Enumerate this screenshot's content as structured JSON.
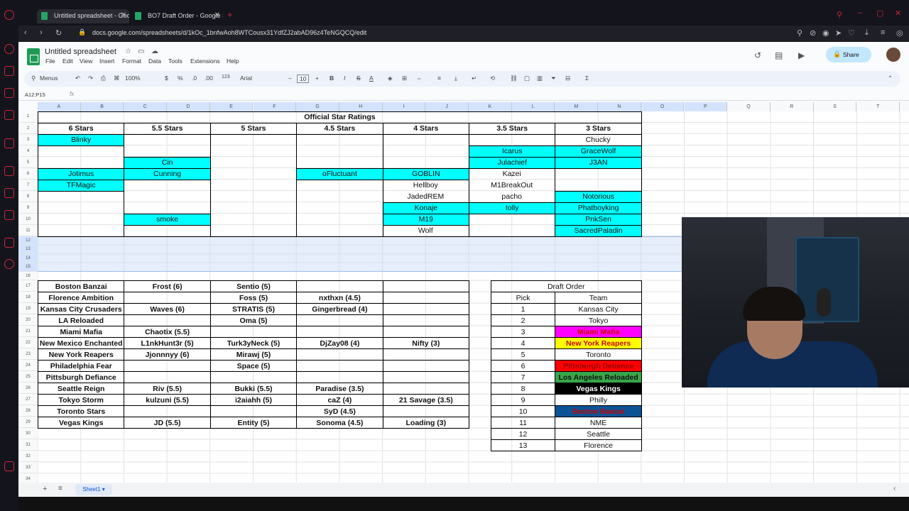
{
  "browser": {
    "tabs": [
      "Untitled spreadsheet - Goo",
      "BO7 Draft Order - Google S"
    ],
    "url": "docs.google.com/spreadsheets/d/1kOc_1bnfwAoh8WTCousx31YdfZJ2abAD96z4TeNGQCQ/edit"
  },
  "doc": {
    "title": "Untitled spreadsheet",
    "menus": [
      "File",
      "Edit",
      "View",
      "Insert",
      "Format",
      "Data",
      "Tools",
      "Extensions",
      "Help"
    ],
    "share_label": "Share"
  },
  "toolbar": {
    "menus_label": "Menus",
    "zoom": "100%",
    "currency": "$",
    "percent": "%",
    "dec_less": ".0",
    "dec_more": ".00",
    "number_format": "123",
    "font": "Arial",
    "font_size": "10"
  },
  "formula_bar": {
    "name_box": "A12:P15",
    "fx": "fx"
  },
  "columns": [
    "A",
    "B",
    "C",
    "D",
    "E",
    "F",
    "G",
    "H",
    "I",
    "J",
    "K",
    "L",
    "M",
    "N",
    "O",
    "P",
    "Q",
    "R",
    "S",
    "T"
  ],
  "rows": [
    "1",
    "2",
    "3",
    "4",
    "5",
    "6",
    "7",
    "8",
    "9",
    "10",
    "11",
    "12",
    "13",
    "14",
    "15",
    "16",
    "17",
    "18",
    "19",
    "20",
    "21",
    "22",
    "23",
    "24",
    "25",
    "26",
    "27",
    "28",
    "29",
    "30",
    "31",
    "32",
    "33",
    "34"
  ],
  "sheet": {
    "tab": "Sheet1"
  },
  "colors": {
    "cyan": "#00ffff",
    "magenta": "#ff00ff",
    "yellow": "#ffff00",
    "red": "#ff0000",
    "green": "#38a649",
    "black": "#000000",
    "blue": "#0b5394"
  },
  "ratings": {
    "title": "Official Star Ratings",
    "headers": [
      "6 Stars",
      "5.5 Stars",
      "5 Stars",
      "4.5 Stars",
      "4 Stars",
      "3.5 Stars",
      "3 Stars"
    ],
    "cells": [
      {
        "r": 3,
        "c": 0,
        "t": "Blinky",
        "hl": true
      },
      {
        "r": 3,
        "c": 6,
        "t": "Chucky",
        "hl": false
      },
      {
        "r": 4,
        "c": 5,
        "t": "Icarus",
        "hl": true
      },
      {
        "r": 4,
        "c": 6,
        "t": "GraceWolf",
        "hl": true
      },
      {
        "r": 5,
        "c": 1,
        "t": "Cin",
        "hl": true
      },
      {
        "r": 5,
        "c": 5,
        "t": "Julachief",
        "hl": true
      },
      {
        "r": 5,
        "c": 6,
        "t": "J3AN",
        "hl": true
      },
      {
        "r": 6,
        "c": 0,
        "t": "Jotimus",
        "hl": true
      },
      {
        "r": 6,
        "c": 1,
        "t": "Cunning",
        "hl": true
      },
      {
        "r": 6,
        "c": 3,
        "t": "oFluctuant",
        "hl": true
      },
      {
        "r": 6,
        "c": 4,
        "t": "GOBLIN",
        "hl": true
      },
      {
        "r": 6,
        "c": 5,
        "t": "Kazei",
        "hl": false
      },
      {
        "r": 7,
        "c": 0,
        "t": "TFMagic",
        "hl": true
      },
      {
        "r": 7,
        "c": 4,
        "t": "Hellboy",
        "hl": false
      },
      {
        "r": 7,
        "c": 5,
        "t": "M1BreakOut",
        "hl": false
      },
      {
        "r": 8,
        "c": 4,
        "t": "JadedREM",
        "hl": false
      },
      {
        "r": 8,
        "c": 5,
        "t": "pacho",
        "hl": false
      },
      {
        "r": 8,
        "c": 6,
        "t": "Notorious",
        "hl": true
      },
      {
        "r": 9,
        "c": 4,
        "t": "Konaje",
        "hl": true
      },
      {
        "r": 9,
        "c": 5,
        "t": "tolly",
        "hl": true
      },
      {
        "r": 9,
        "c": 6,
        "t": "Phatboyking",
        "hl": true
      },
      {
        "r": 10,
        "c": 1,
        "t": "smoke",
        "hl": true
      },
      {
        "r": 10,
        "c": 4,
        "t": "M19",
        "hl": true
      },
      {
        "r": 10,
        "c": 6,
        "t": "PnkSen",
        "hl": true
      },
      {
        "r": 11,
        "c": 4,
        "t": "Wolf",
        "hl": false
      },
      {
        "r": 11,
        "c": 6,
        "t": "SacredPaladin",
        "hl": true
      }
    ]
  },
  "teams": [
    [
      "Boston Banzai",
      "Frost (6)",
      "Sentio (5)",
      "",
      ""
    ],
    [
      "Florence Ambition",
      "",
      "Foss (5)",
      "nxthxn (4.5)",
      ""
    ],
    [
      "Kansas City Crusaders",
      "Waves (6)",
      "STRATIS (5)",
      "Gingerbread (4)",
      ""
    ],
    [
      "LA Reloaded",
      "",
      "Oma (5)",
      "",
      ""
    ],
    [
      "Miami Mafia",
      "Chaotix (5.5)",
      "",
      "",
      ""
    ],
    [
      "New Mexico Enchanted",
      "L1nkHunt3r (5)",
      "Turk3yNeck (5)",
      "DjZay08 (4)",
      "Nifty (3)"
    ],
    [
      "New York Reapers",
      "Jjonnnyy (6)",
      "Mirawj (5)",
      "",
      ""
    ],
    [
      "Philadelphia Fear",
      "",
      "Space (5)",
      "",
      ""
    ],
    [
      "Pittsburgh Defiance",
      "",
      "",
      "",
      ""
    ],
    [
      "Seattle Reign",
      "Riv (5.5)",
      "Bukki (5.5)",
      "Paradise (3.5)",
      ""
    ],
    [
      "Tokyo Storm",
      "kulzuni (5.5)",
      "i2aiahh (5)",
      "caZ (4)",
      "21 Savage (3.5)"
    ],
    [
      "Toronto Stars",
      "",
      "",
      "SyD (4.5)",
      ""
    ],
    [
      "Vegas Kings",
      "JD (5.5)",
      "Entity (5)",
      "Sonoma (4.5)",
      "Loading (3)"
    ]
  ],
  "draft": {
    "title": "Draft Order",
    "headers": [
      "Pick",
      "Team"
    ],
    "rows": [
      {
        "pick": "1",
        "team": "Kansas City",
        "bg": "",
        "fg": ""
      },
      {
        "pick": "2",
        "team": "Tokyo",
        "bg": "",
        "fg": ""
      },
      {
        "pick": "3",
        "team": "Miami Mafia",
        "bg": "#ff00ff",
        "fg": "#cc0000"
      },
      {
        "pick": "4",
        "team": "New York Reapers",
        "bg": "#ffff00",
        "fg": "#cc0000"
      },
      {
        "pick": "5",
        "team": "Toronto",
        "bg": "",
        "fg": ""
      },
      {
        "pick": "6",
        "team": "Pittsburgh Defiance",
        "bg": "#ff0000",
        "fg": "#990000"
      },
      {
        "pick": "7",
        "team": "Los Angeles Reloaded",
        "bg": "#38a649",
        "fg": "#111111"
      },
      {
        "pick": "8",
        "team": "Vegas Kings",
        "bg": "#000000",
        "fg": "#ffffff"
      },
      {
        "pick": "9",
        "team": "Philly",
        "bg": "",
        "fg": ""
      },
      {
        "pick": "10",
        "team": "Boston Banzai",
        "bg": "#0b5394",
        "fg": "#cc0000"
      },
      {
        "pick": "11",
        "team": "NME",
        "bg": "",
        "fg": ""
      },
      {
        "pick": "12",
        "team": "Seattle",
        "bg": "",
        "fg": ""
      },
      {
        "pick": "13",
        "team": "Florence",
        "bg": "",
        "fg": ""
      }
    ]
  }
}
